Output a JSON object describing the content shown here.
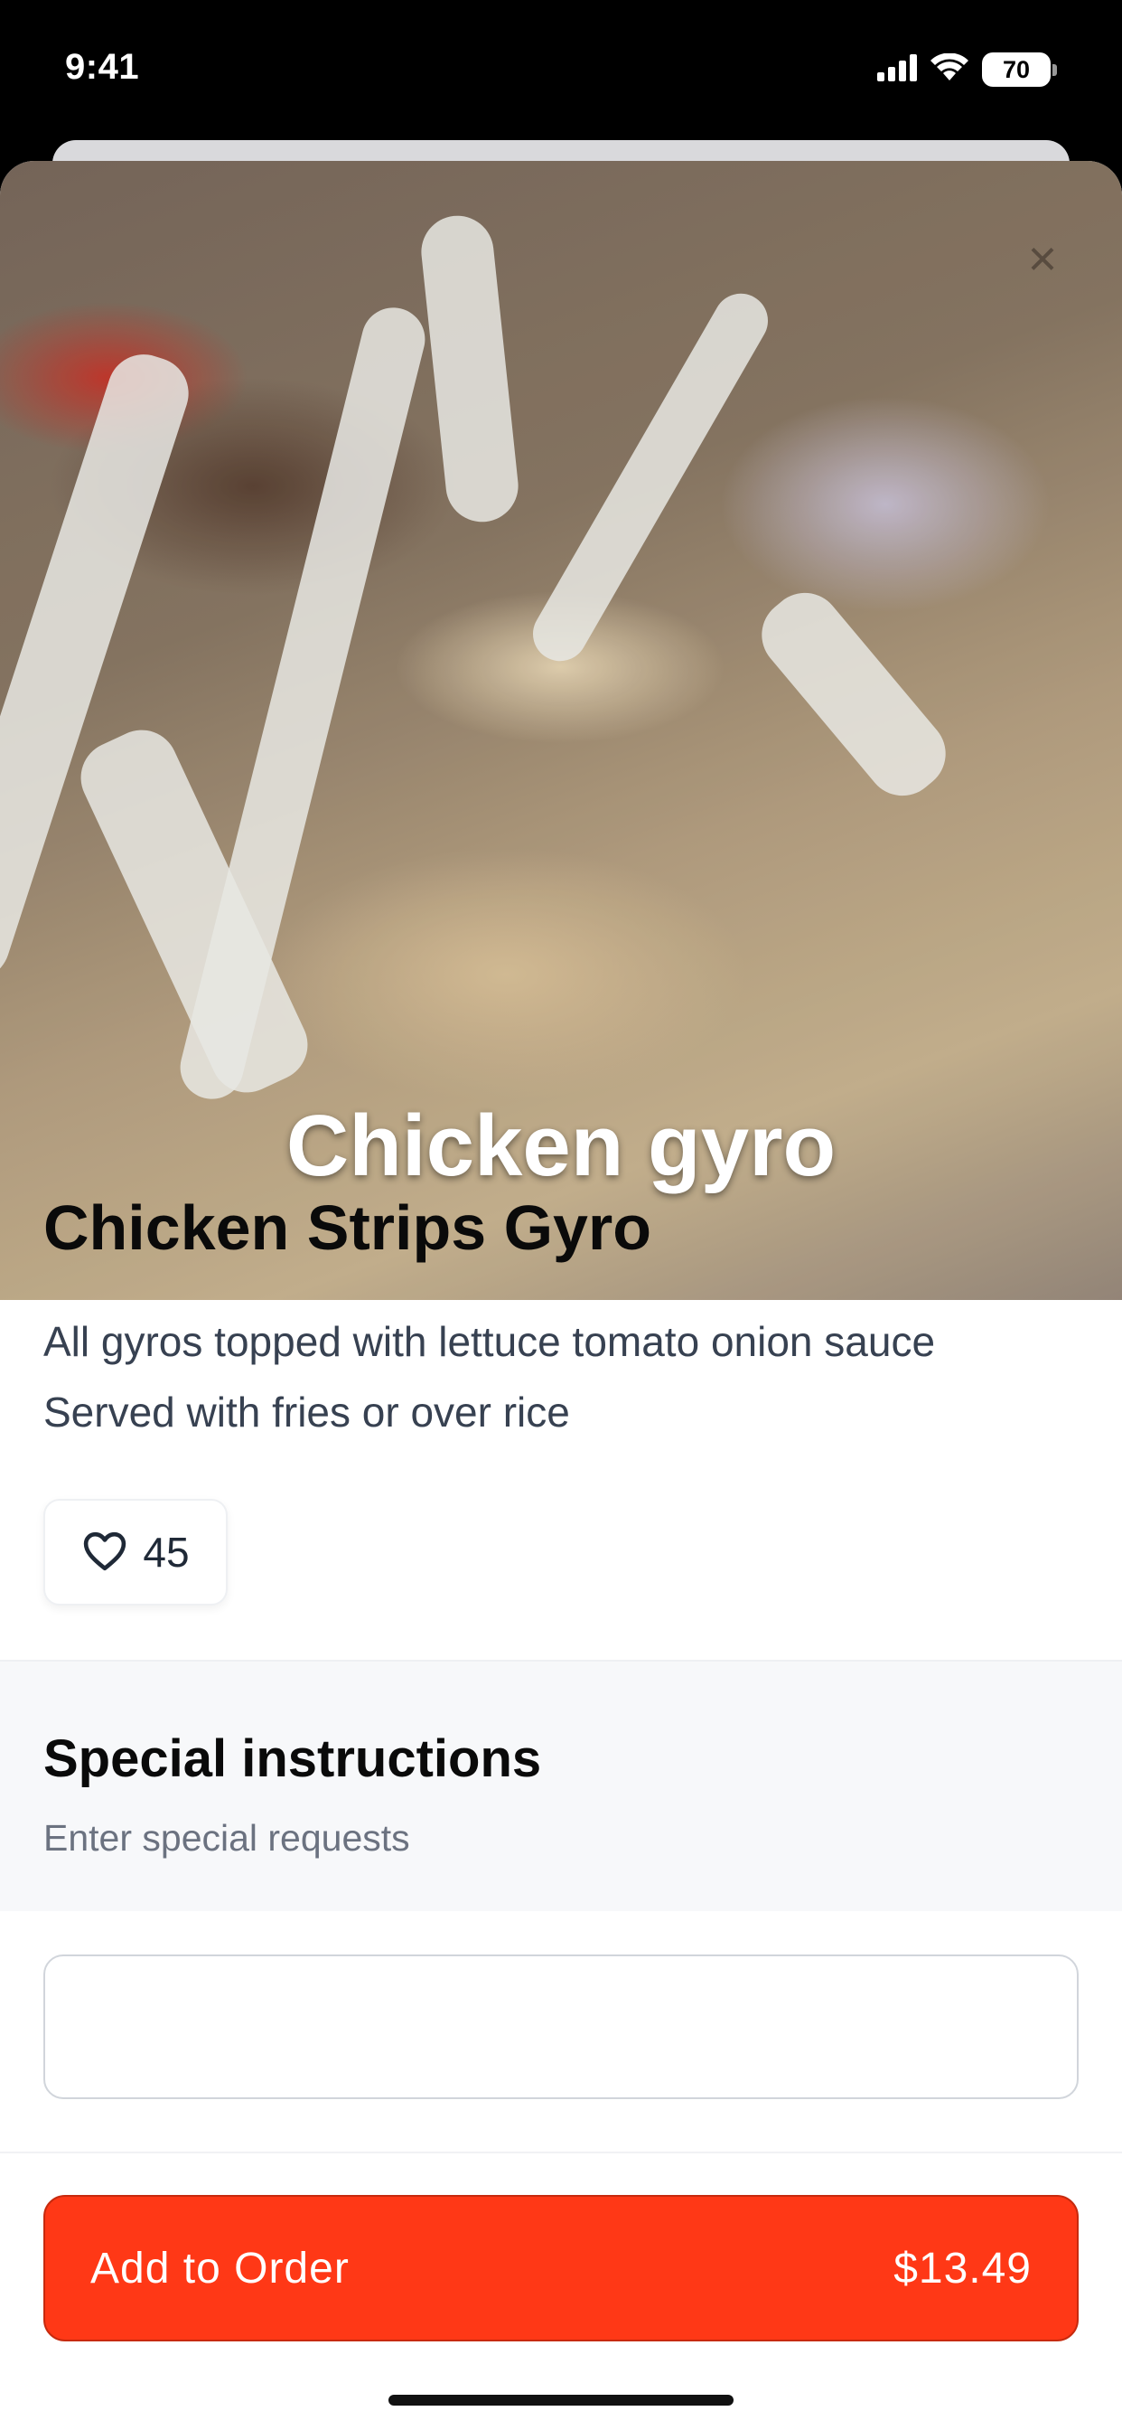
{
  "status_bar": {
    "time": "9:41",
    "battery": "70",
    "icons": [
      "cellular-signal-icon",
      "wifi-icon",
      "battery-icon"
    ]
  },
  "hero": {
    "title": "Chicken gyro",
    "close_icon": "close-icon"
  },
  "item": {
    "title": "Chicken Strips Gyro",
    "description_line1": "All gyros topped with lettuce tomato onion sauce",
    "description_line2": "Served with fries or over rice",
    "like_count": "45",
    "like_icon": "heart-icon"
  },
  "special_instructions": {
    "title": "Special instructions",
    "subtitle": "Enter special requests",
    "input_value": ""
  },
  "order_button": {
    "label": "Add to Order",
    "price": "$13.49"
  },
  "colors": {
    "accent": "#ff3816",
    "text_primary": "#0a0a0a",
    "text_secondary": "#374151",
    "text_muted": "#6b7280",
    "section_bg": "#f7f8fa"
  }
}
